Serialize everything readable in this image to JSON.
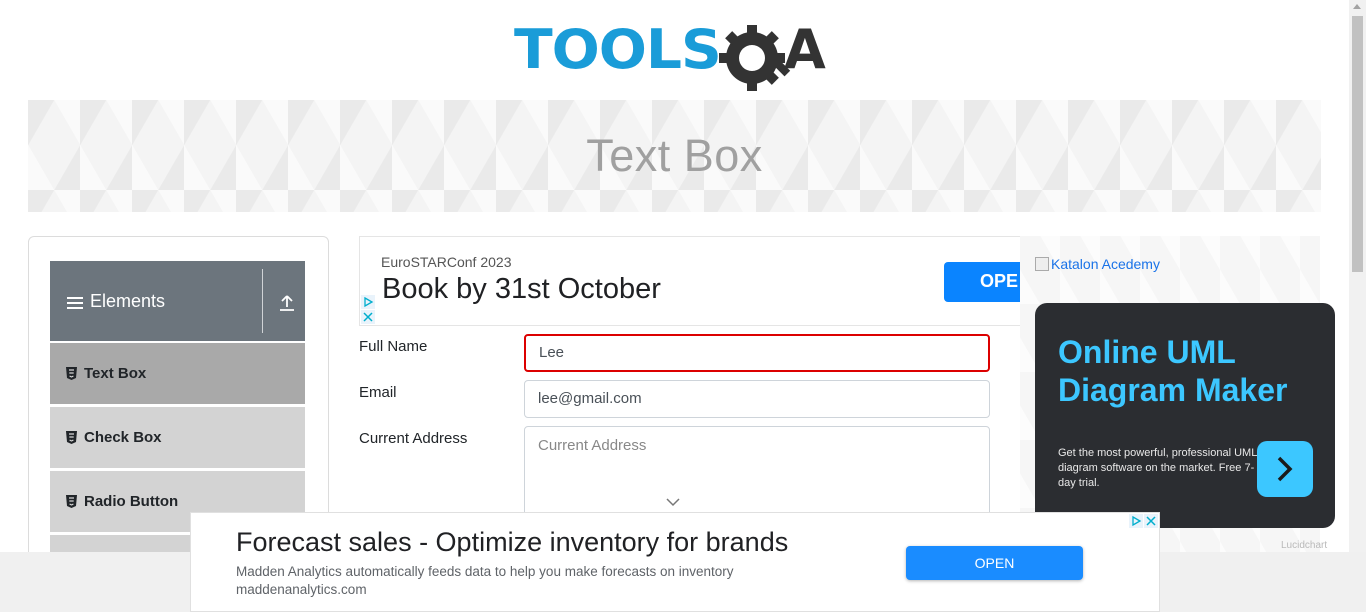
{
  "header": {
    "logo_text": "TOOLSQA"
  },
  "page": {
    "title": "Text Box"
  },
  "sidebar": {
    "group": {
      "label": "Elements",
      "icon": "list-icon",
      "toggle_icon": "upload-icon"
    },
    "items": [
      {
        "label": "Text Box",
        "active": true
      },
      {
        "label": "Check Box",
        "active": false
      },
      {
        "label": "Radio Button",
        "active": false
      }
    ]
  },
  "ad_top": {
    "subtitle": "EuroSTARConf 2023",
    "headline": "Book by 31st October",
    "button": "OPE"
  },
  "form": {
    "full_name": {
      "label": "Full Name",
      "value": "Lee"
    },
    "email": {
      "label": "Email",
      "value": "lee@gmail.com"
    },
    "current_address": {
      "label": "Current Address",
      "placeholder": "Current Address"
    }
  },
  "right_ad": {
    "broken_image_alt": "Katalon Acedemy",
    "title": "Online UML Diagram Maker",
    "description": "Get the most powerful, professional UML diagram software on the market. Free 7-day trial.",
    "brand": "Lucidchart",
    "accent_color": "#3cc7ff"
  },
  "bottom_ad": {
    "headline": "Forecast sales - Optimize inventory for brands",
    "description": "Madden Analytics automatically feeds data to help you make forecasts on inventory",
    "url": "maddenanalytics.com",
    "button": "OPEN"
  }
}
